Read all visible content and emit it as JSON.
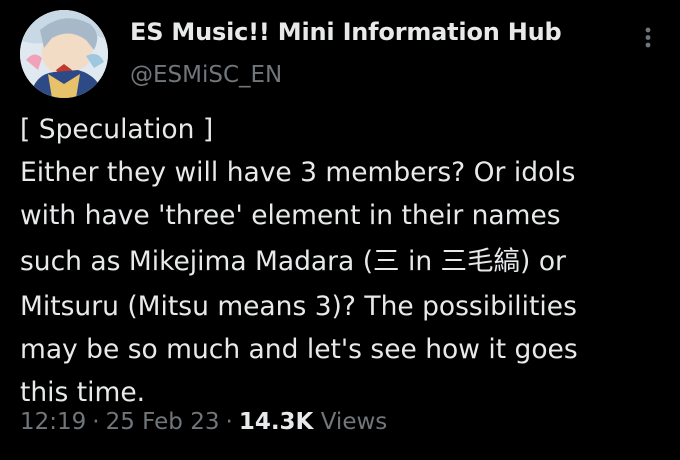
{
  "author": {
    "display_name": "ES Music!! Mini Information Hub",
    "handle": "@ESMiSC_EN",
    "avatar": "avatar-anime-character"
  },
  "tweet": {
    "lines": [
      "[ Speculation ]",
      "Either they will have 3 members? Or idols",
      "with have 'three' element in their names",
      "such as Mikejima Madara (三 in 三毛縞) or",
      "Mitsuru (Mitsu means 3)? The possibilities",
      "may be so much and let's see how it goes",
      "this time."
    ]
  },
  "meta": {
    "time": "12:19",
    "date": "25 Feb 23",
    "separator": "·",
    "views_count": "14.3K",
    "views_label": "Views"
  },
  "icons": {
    "more": "more-vertical-icon"
  },
  "colors": {
    "background": "#000000",
    "primary_text": "#e7e9ea",
    "secondary_text": "#71767b"
  }
}
